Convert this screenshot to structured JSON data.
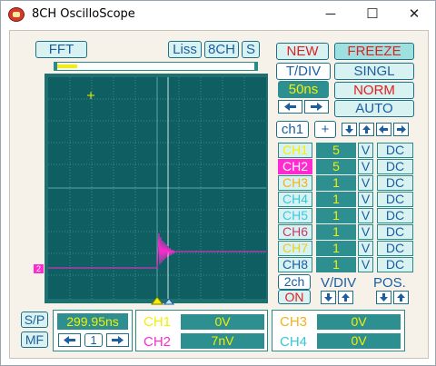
{
  "window": {
    "title": "8CH OscilloScope",
    "minimize": "─",
    "maximize": "☐",
    "close": "✕"
  },
  "top": {
    "fft": "FFT",
    "liss": "Liss",
    "eight_ch": "8CH",
    "s": "S"
  },
  "right": {
    "new": "NEW",
    "freeze": "FREEZE",
    "tdiv_label": "T/DIV",
    "tdiv_value": "50ns",
    "singl": "SINGL",
    "norm": "NORM",
    "auto": "AUTO",
    "ch1_select": "ch1",
    "plus": "+"
  },
  "channels": [
    {
      "name": "CH1",
      "value": "5",
      "unit": "V",
      "coupling": "DC",
      "color": "#f4f000",
      "highlight": false
    },
    {
      "name": "CH2",
      "value": "5",
      "unit": "V",
      "coupling": "DC",
      "color": "#ff2ad0",
      "highlight": true
    },
    {
      "name": "CH3",
      "value": "1",
      "unit": "V",
      "coupling": "DC",
      "color": "#f2b21a",
      "highlight": false
    },
    {
      "name": "CH4",
      "value": "1",
      "unit": "V",
      "coupling": "DC",
      "color": "#34c8d8",
      "highlight": false
    },
    {
      "name": "CH5",
      "value": "1",
      "unit": "V",
      "coupling": "DC",
      "color": "#3cc8e8",
      "highlight": false
    },
    {
      "name": "CH6",
      "value": "1",
      "unit": "V",
      "coupling": "DC",
      "color": "#c23a6a",
      "highlight": false
    },
    {
      "name": "CH7",
      "value": "1",
      "unit": "V",
      "coupling": "DC",
      "color": "#e8d020",
      "highlight": false
    },
    {
      "name": "CH8",
      "value": "1",
      "unit": "V",
      "coupling": "DC",
      "color": "#1b5fa0",
      "highlight": false
    }
  ],
  "lower_right": {
    "two_ch": "2ch",
    "on": "ON",
    "vdiv": "V/DIV",
    "pos": "POS."
  },
  "bottom": {
    "sp": "S/P",
    "mf": "MF",
    "time_value": "299.95ns",
    "step": "1",
    "ch1_label": "CH1",
    "ch1_value": "0V",
    "ch2_label": "CH2",
    "ch2_value": "7nV",
    "ch3_label": "CH3",
    "ch3_value": "0V",
    "ch4_label": "CH4",
    "ch4_value": "0V"
  },
  "marker": {
    "ch2_tag": "2"
  },
  "colors": {
    "scope_bg": "#0e5e62",
    "grid": "#3a8a8e",
    "ch2_trace": "#ff2ad0",
    "ch1_value_color": "#f4f000"
  }
}
